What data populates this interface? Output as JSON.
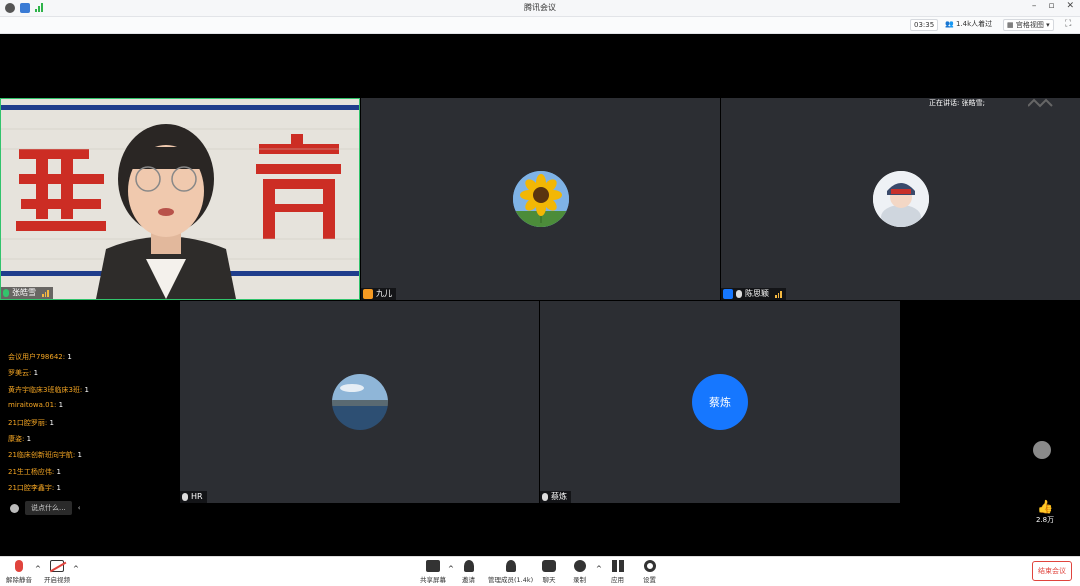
{
  "window": {
    "title": "腾讯会议"
  },
  "info": {
    "timer": "03:35",
    "attendees": "1.4k人着过",
    "view": "宫格视图"
  },
  "speaking": "正在讲话: 张皓雪;",
  "tiles": [
    {
      "name": "张皓雪"
    },
    {
      "name": "九儿"
    },
    {
      "name": "陈思颖"
    },
    {
      "name": "HR"
    },
    {
      "name": "蔡炼",
      "avatar_text": "蔡炼"
    }
  ],
  "chat": [
    {
      "user": "会议用户798642:",
      "count": "1"
    },
    {
      "user": "罗美云:",
      "count": "1"
    },
    {
      "user": "黄卉宇临床3班临床3班:",
      "count": "1"
    },
    {
      "user": "miraitowa.01:",
      "count": "1"
    },
    {
      "user": "21口腔罗丽:",
      "count": "1"
    },
    {
      "user": "康姿:",
      "count": "1"
    },
    {
      "user": "21临床创新班向宇航:",
      "count": "1"
    },
    {
      "user": "21生工杨应伟:",
      "count": "1"
    },
    {
      "user": "21口腔李鑫宇:",
      "count": "1"
    }
  ],
  "chat_input": {
    "placeholder": "说点什么..."
  },
  "likes": "2.8万",
  "toolbar": {
    "mute": "解除静音",
    "video": "开启视频",
    "share": "共享屏幕",
    "invite": "邀请",
    "members": "管理成员(1.4k)",
    "chat": "聊天",
    "record": "录制",
    "apps": "应用",
    "settings": "设置",
    "end": "结束会议"
  },
  "colors": {
    "accent": "#1677ff",
    "end": "#e0443d",
    "chat_name": "#f5a623",
    "active_border": "#32c36c"
  }
}
